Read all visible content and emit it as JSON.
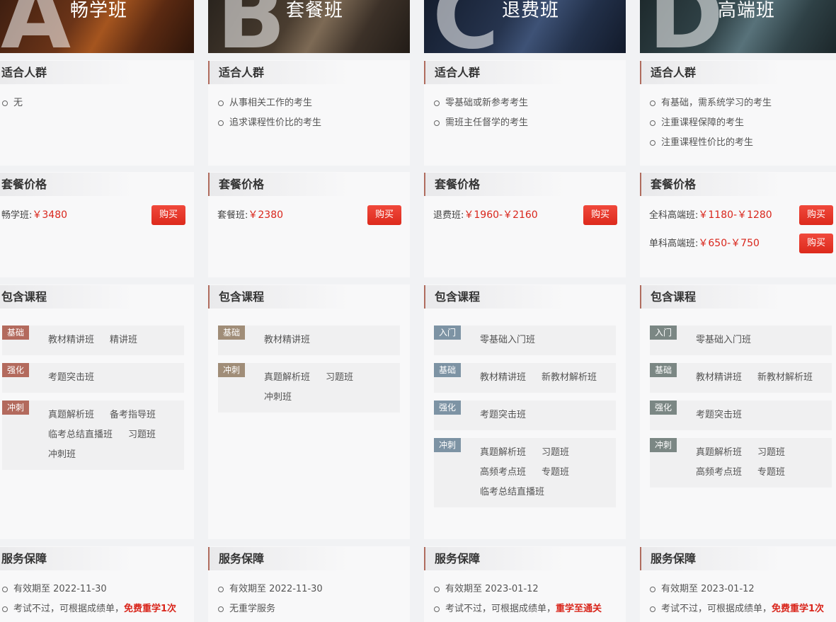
{
  "labels": {
    "people": "适合人群",
    "price": "套餐价格",
    "course": "包含课程",
    "service": "服务保障",
    "buy": "购买"
  },
  "plans": [
    {
      "letter": "A",
      "name": "畅学班",
      "people": [
        "无"
      ],
      "prices": [
        {
          "label": "畅学班:",
          "value": "￥3480"
        }
      ],
      "courses": [
        {
          "tag": "基础",
          "items": [
            "教材精讲班",
            "精讲班"
          ]
        },
        {
          "tag": "强化",
          "items": [
            "考题突击班"
          ]
        },
        {
          "tag": "冲刺",
          "items": [
            "真题解析班",
            "备考指导班",
            "临考总结直播班",
            "习题班",
            "冲刺班"
          ]
        }
      ],
      "service": [
        {
          "text": "有效期至 2022-11-30",
          "highlight": ""
        },
        {
          "text": "考试不过，可根据成绩单，",
          "highlight": "免费重学1次"
        }
      ]
    },
    {
      "letter": "B",
      "name": "套餐班",
      "people": [
        "从事相关工作的考生",
        "追求课程性价比的考生"
      ],
      "prices": [
        {
          "label": "套餐班:",
          "value": "￥2380"
        }
      ],
      "courses": [
        {
          "tag": "基础",
          "items": [
            "教材精讲班"
          ]
        },
        {
          "tag": "冲刺",
          "items": [
            "真题解析班",
            "习题班",
            "冲刺班"
          ]
        }
      ],
      "service": [
        {
          "text": "有效期至 2022-11-30",
          "highlight": ""
        },
        {
          "text": "无重学服务",
          "highlight": ""
        }
      ]
    },
    {
      "letter": "C",
      "name": "退费班",
      "people": [
        "零基础或新参考考生",
        "需班主任督学的考生"
      ],
      "prices": [
        {
          "label": "退费班:",
          "value": "￥1960-￥2160"
        }
      ],
      "courses": [
        {
          "tag": "入门",
          "items": [
            "零基础入门班"
          ]
        },
        {
          "tag": "基础",
          "items": [
            "教材精讲班",
            "新教材解析班"
          ]
        },
        {
          "tag": "强化",
          "items": [
            "考题突击班"
          ]
        },
        {
          "tag": "冲刺",
          "items": [
            "真题解析班",
            "习题班",
            "高频考点班",
            "专题班",
            "临考总结直播班"
          ]
        }
      ],
      "service": [
        {
          "text": "有效期至 2023-01-12",
          "highlight": ""
        },
        {
          "text": "考试不过，可根据成绩单，",
          "highlight": "重学至通关"
        }
      ]
    },
    {
      "letter": "D",
      "name": "高端班",
      "people": [
        "有基础，需系统学习的考生",
        "注重课程保障的考生",
        "注重课程性价比的考生"
      ],
      "prices": [
        {
          "label": "全科高端班:",
          "value": "￥1180-￥1280"
        },
        {
          "label": "单科高端班:",
          "value": "￥650-￥750"
        }
      ],
      "courses": [
        {
          "tag": "入门",
          "items": [
            "零基础入门班"
          ]
        },
        {
          "tag": "基础",
          "items": [
            "教材精讲班",
            "新教材解析班"
          ]
        },
        {
          "tag": "强化",
          "items": [
            "考题突击班"
          ]
        },
        {
          "tag": "冲刺",
          "items": [
            "真题解析班",
            "习题班",
            "高频考点班",
            "专题班"
          ]
        }
      ],
      "service": [
        {
          "text": "有效期至 2023-01-12",
          "highlight": ""
        },
        {
          "text": "考试不过，可根据成绩单，",
          "highlight": "免费重学1次"
        }
      ]
    }
  ],
  "theme": {
    "accent_red": "#d9261c",
    "tag_colors": [
      "#b36a5d",
      "#a08d78",
      "#7d93a4",
      "#7b8784"
    ]
  }
}
